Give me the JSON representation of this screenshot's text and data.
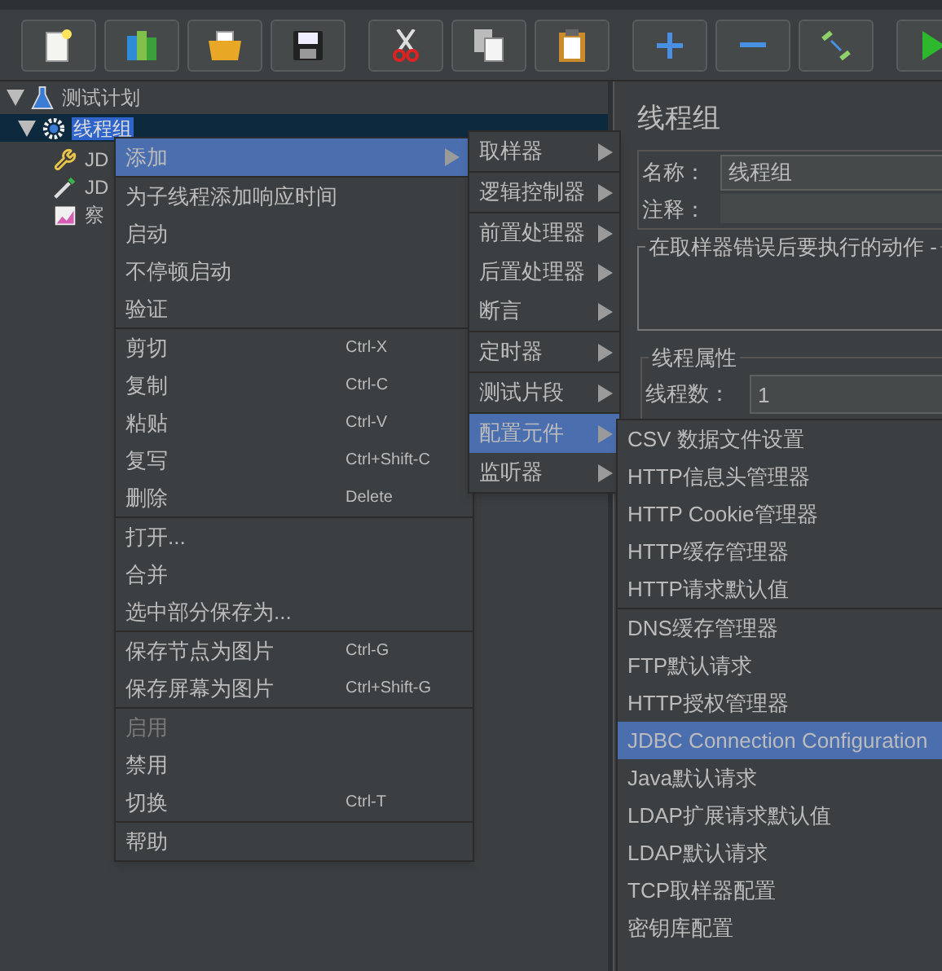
{
  "tree": [
    {
      "label": "测试计划",
      "kind": "plan",
      "selected": false,
      "expanded": true,
      "children": [
        {
          "label": "线程组",
          "kind": "thread_group",
          "selected": true,
          "expanded": true,
          "children": [
            {
              "label": "JD",
              "kind": "config"
            },
            {
              "label": "JD",
              "kind": "preprocessor"
            },
            {
              "label": "察",
              "kind": "listener"
            }
          ]
        }
      ]
    }
  ],
  "context_menu": {
    "groups": [
      [
        {
          "label": "添加",
          "submenu": true,
          "selected": true,
          "disabled": false
        }
      ],
      [
        {
          "label": "为子线程添加响应时间",
          "submenu": false,
          "selected": false,
          "disabled": false
        },
        {
          "label": "启动",
          "submenu": false,
          "selected": false,
          "disabled": false
        },
        {
          "label": "不停顿启动",
          "submenu": false,
          "selected": false,
          "disabled": false
        },
        {
          "label": "验证",
          "submenu": false,
          "selected": false,
          "disabled": false
        }
      ],
      [
        {
          "label": "剪切",
          "shortcut": "Ctrl-X",
          "submenu": false,
          "selected": false,
          "disabled": false
        },
        {
          "label": "复制",
          "shortcut": "Ctrl-C",
          "submenu": false,
          "selected": false,
          "disabled": false
        },
        {
          "label": "粘贴",
          "shortcut": "Ctrl-V",
          "submenu": false,
          "selected": false,
          "disabled": false
        },
        {
          "label": "复写",
          "shortcut": "Ctrl+Shift-C",
          "submenu": false,
          "selected": false,
          "disabled": false
        },
        {
          "label": "删除",
          "shortcut": "Delete",
          "submenu": false,
          "selected": false,
          "disabled": false
        }
      ],
      [
        {
          "label": "打开...",
          "submenu": false,
          "selected": false,
          "disabled": false
        },
        {
          "label": "合并",
          "submenu": false,
          "selected": false,
          "disabled": false
        },
        {
          "label": "选中部分保存为...",
          "submenu": false,
          "selected": false,
          "disabled": false
        }
      ],
      [
        {
          "label": "保存节点为图片",
          "shortcut": "Ctrl-G",
          "submenu": false,
          "selected": false,
          "disabled": false
        },
        {
          "label": "保存屏幕为图片",
          "shortcut": "Ctrl+Shift-G",
          "submenu": false,
          "selected": false,
          "disabled": false
        }
      ],
      [
        {
          "label": "启用",
          "submenu": false,
          "selected": false,
          "disabled": true
        },
        {
          "label": "禁用",
          "submenu": false,
          "selected": false,
          "disabled": false
        },
        {
          "label": "切换",
          "shortcut": "Ctrl-T",
          "submenu": false,
          "selected": false,
          "disabled": false
        }
      ],
      [
        {
          "label": "帮助",
          "submenu": false,
          "selected": false,
          "disabled": false
        }
      ]
    ]
  },
  "add_submenu": {
    "groups": [
      [
        {
          "label": "取样器",
          "submenu": true,
          "selected": false
        }
      ],
      [
        {
          "label": "逻辑控制器",
          "submenu": true,
          "selected": false
        }
      ],
      [
        {
          "label": "前置处理器",
          "submenu": true,
          "selected": false
        },
        {
          "label": "后置处理器",
          "submenu": true,
          "selected": false
        },
        {
          "label": "断言",
          "submenu": true,
          "selected": false
        }
      ],
      [
        {
          "label": "定时器",
          "submenu": true,
          "selected": false
        }
      ],
      [
        {
          "label": "测试片段",
          "submenu": true,
          "selected": false
        }
      ],
      [
        {
          "label": "配置元件",
          "submenu": true,
          "selected": true
        },
        {
          "label": "监听器",
          "submenu": true,
          "selected": false
        }
      ]
    ]
  },
  "config_submenu": {
    "groups": [
      [
        {
          "label": "CSV 数据文件设置",
          "selected": false
        },
        {
          "label": "HTTP信息头管理器",
          "selected": false
        },
        {
          "label": "HTTP Cookie管理器",
          "selected": false
        },
        {
          "label": "HTTP缓存管理器",
          "selected": false
        },
        {
          "label": "HTTP请求默认值",
          "selected": false
        }
      ],
      [
        {
          "label": "DNS缓存管理器",
          "selected": false
        },
        {
          "label": "FTP默认请求",
          "selected": false
        },
        {
          "label": "HTTP授权管理器",
          "selected": false
        },
        {
          "label": "JDBC Connection Configuration",
          "selected": true
        },
        {
          "label": "Java默认请求",
          "selected": false
        },
        {
          "label": "LDAP扩展请求默认值",
          "selected": false
        },
        {
          "label": "LDAP默认请求",
          "selected": false
        },
        {
          "label": "TCP取样器配置",
          "selected": false
        },
        {
          "label": "密钥库配置",
          "selected": false
        }
      ]
    ]
  },
  "panel": {
    "title": "线程组",
    "name_label": "名称：",
    "name_value": "线程组",
    "comment_label": "注释：",
    "error_group_title": "在取样器错误后要执行的动作 -",
    "thread_group_title": "线程属性",
    "threads_label": "线程数：",
    "threads_value": "1"
  }
}
